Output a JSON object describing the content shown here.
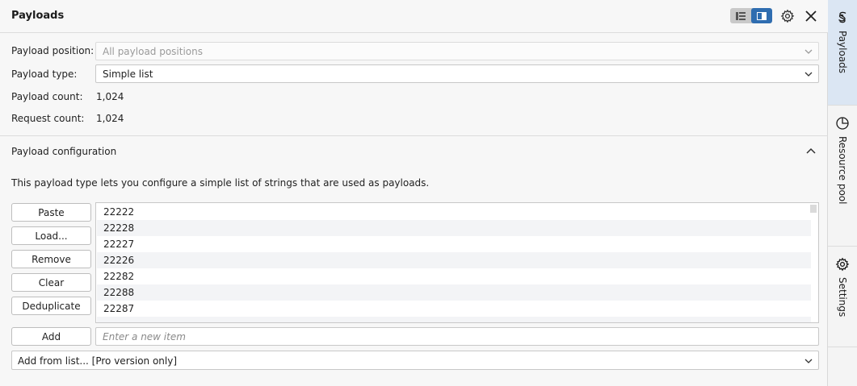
{
  "panel": {
    "title": "Payloads"
  },
  "fields": {
    "payload_position_label": "Payload position:",
    "payload_position_value": "All payload positions",
    "payload_type_label": "Payload type:",
    "payload_type_value": "Simple list",
    "payload_count_label": "Payload count:",
    "payload_count_value": "1,024",
    "request_count_label": "Request count:",
    "request_count_value": "1,024"
  },
  "config": {
    "section_title": "Payload configuration",
    "description": "This payload type lets you configure a simple list of strings that are used as payloads.",
    "buttons": {
      "paste": "Paste",
      "load": "Load...",
      "remove": "Remove",
      "clear": "Clear",
      "deduplicate": "Deduplicate",
      "add": "Add"
    },
    "items": [
      "22222",
      "22228",
      "22227",
      "22226",
      "22282",
      "22288",
      "22287"
    ],
    "new_item_placeholder": "Enter a new item",
    "add_from_list": "Add from list... [Pro version only]"
  },
  "sidebar": {
    "tabs": [
      {
        "label": "Payloads",
        "icon": "payloads-icon",
        "active": true
      },
      {
        "label": "Resource pool",
        "icon": "pie-chart-icon",
        "active": false
      },
      {
        "label": "Settings",
        "icon": "gear-icon",
        "active": false
      }
    ]
  },
  "colors": {
    "accent": "#2f6db0",
    "active_tab": "#dbe6f3"
  }
}
